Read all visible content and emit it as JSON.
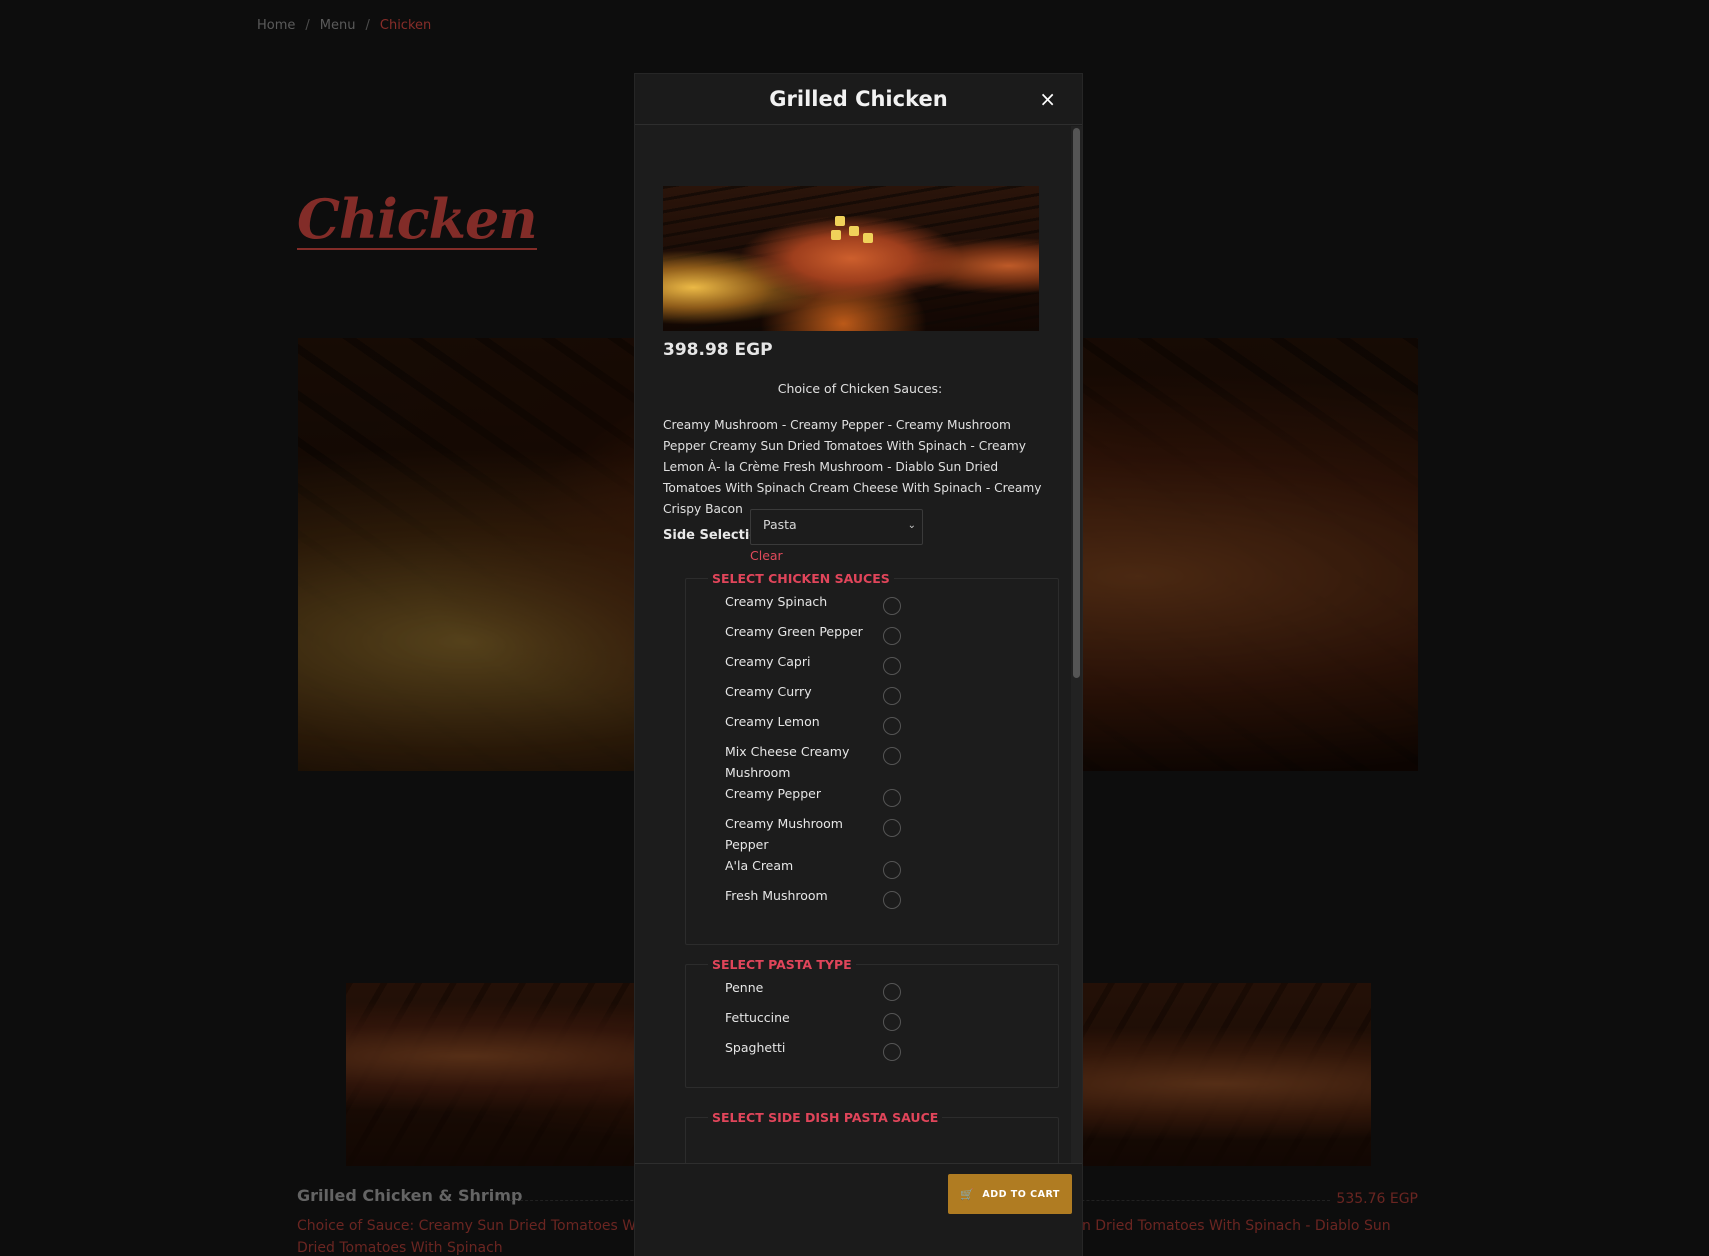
{
  "breadcrumb": {
    "home": "Home",
    "menu": "Menu",
    "current": "Chicken",
    "sep": "/"
  },
  "page": {
    "title": "Chicken"
  },
  "background_item": {
    "title": "Grilled Chicken & Shrimp",
    "price": "535.76 EGP",
    "description": "Choice of Sauce: Creamy Sun Dried Tomatoes With Spinach - Al Creme - Creamy Crispy Bacon Creamy Cajun Sun Dried Tomatoes With Spinach - Diablo Sun Dried Tomatoes With Spinach"
  },
  "modal": {
    "title": "Grilled Chicken",
    "close_icon": "×",
    "price": "398.98 EGP",
    "choice_heading": "Choice of  Chicken Sauces:",
    "description": "Creamy Mushroom - Creamy Pepper - Creamy Mushroom Pepper Creamy Sun Dried Tomatoes With Spinach - Creamy Lemon À- la Crème Fresh Mushroom - Diablo Sun Dried Tomatoes With Spinach Cream Cheese With Spinach - Creamy Crispy Bacon",
    "side_selection": {
      "label": "Side Selection",
      "value": "Pasta",
      "chevron": "⌄",
      "clear": "Clear"
    },
    "sauce_group": {
      "legend": "SELECT CHICKEN SAUCES",
      "options": [
        "Creamy Spinach",
        "Creamy Green Pepper",
        "Creamy Capri",
        "Creamy Curry",
        "Creamy Lemon",
        "Mix Cheese Creamy Mushroom",
        "Creamy Pepper",
        "Creamy Mushroom Pepper",
        "A'la Cream",
        "Fresh Mushroom"
      ]
    },
    "pasta_group": {
      "legend": "SELECT PASTA TYPE",
      "options": [
        "Penne",
        "Fettuccine",
        "Spaghetti"
      ]
    },
    "side_sauce_group": {
      "legend": "SELECT SIDE DISH PASTA SAUCE"
    },
    "add_to_cart": {
      "icon": "🛒",
      "label": "ADD TO CART"
    }
  }
}
